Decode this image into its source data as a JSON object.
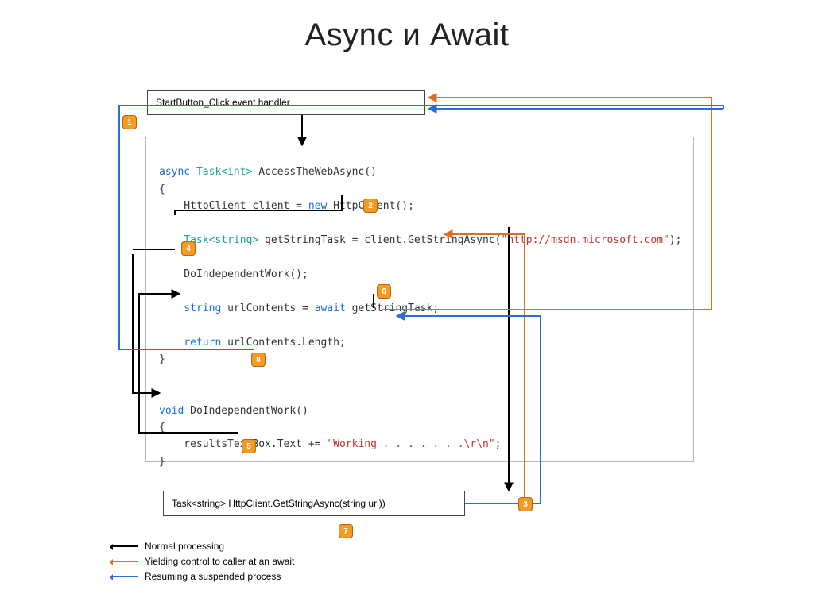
{
  "title": "Async и Await",
  "boxes": {
    "top": "StartButton_Click event handler",
    "bottom": "Task<string> HttpClient.GetStringAsync(string url))"
  },
  "code": {
    "l1a": "async",
    "l1b": "Task",
    "l1c": "<int>",
    "l1d": " AccessTheWebAsync()",
    "l2": "{",
    "l3a": "    HttpClient client = ",
    "l3b": "new",
    "l3c": " HttpClient();",
    "l4a": "    Task",
    "l4b": "<string>",
    "l4c": " getStringTask = client.GetStringAsync(",
    "l4str": "\"http://msdn.microsoft.com\"",
    "l4d": ");",
    "l5": "    DoIndependentWork();",
    "l6a": "    string",
    "l6b": " urlContents = ",
    "l6c": "await",
    "l6d": " getStringTask;",
    "l7a": "    return",
    "l7b": " urlContents.Length;",
    "l8": "}",
    "l9a": "void",
    "l9b": " DoIndependentWork()",
    "l10": "{",
    "l11a": "    resultsTextBox.Text += ",
    "l11str": "\"Working . . . . . . .\\r\\n\"",
    "l11b": ";",
    "l12": "}"
  },
  "steps": {
    "s1": "1",
    "s2": "2",
    "s3": "3",
    "s4": "4",
    "s5": "5",
    "s6": "6",
    "s7": "7",
    "s8": "8"
  },
  "legend": {
    "normal": "Normal processing",
    "yield": "Yielding control to caller at an await",
    "resume": "Resuming a suspended process"
  },
  "colors": {
    "black": "#000000",
    "orange": "#e36b1b",
    "blue": "#2a6fd6"
  }
}
